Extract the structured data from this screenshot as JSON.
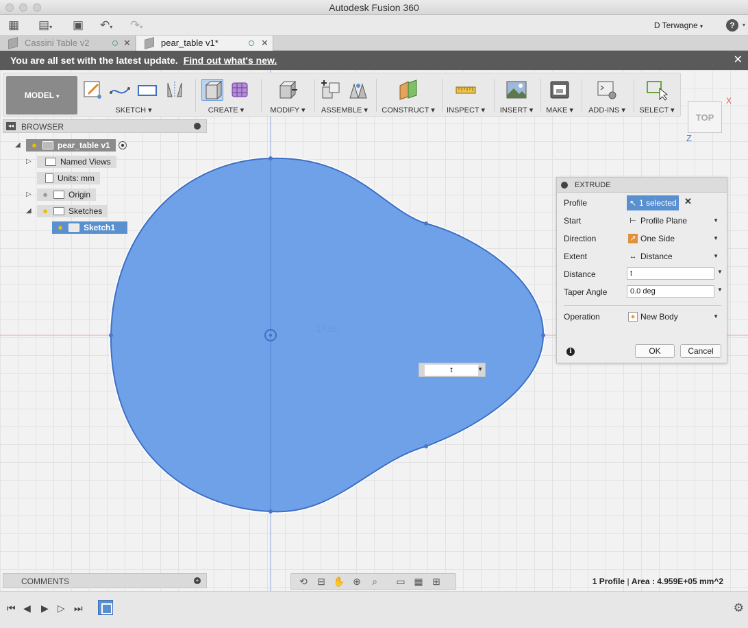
{
  "window": {
    "title": "Autodesk Fusion 360"
  },
  "appbar": {
    "user": "D Terwagne",
    "help_icon": "?",
    "icons": [
      "grid-icon",
      "file-icon",
      "save-icon",
      "undo-icon",
      "redo-icon"
    ]
  },
  "tabs": [
    {
      "label": "Cassini Table v2",
      "active": false
    },
    {
      "label": "pear_table v1*",
      "active": true
    }
  ],
  "banner": {
    "text": "You are all set with the latest update.",
    "link": "Find out what's new."
  },
  "toolbar": {
    "workspace": "MODEL",
    "groups": [
      {
        "label": "SKETCH"
      },
      {
        "label": "CREATE"
      },
      {
        "label": "MODIFY"
      },
      {
        "label": "ASSEMBLE"
      },
      {
        "label": "CONSTRUCT"
      },
      {
        "label": "INSPECT"
      },
      {
        "label": "INSERT"
      },
      {
        "label": "MAKE"
      },
      {
        "label": "ADD-INS"
      },
      {
        "label": "SELECT"
      }
    ]
  },
  "viewcube": {
    "face": "TOP",
    "x_axis": "X",
    "z_axis": "Z"
  },
  "browser": {
    "title": "BROWSER",
    "root": "pear_table v1",
    "items": [
      {
        "label": "Named Views"
      },
      {
        "label": "Units: mm"
      },
      {
        "label": "Origin"
      },
      {
        "label": "Sketches"
      },
      {
        "label": "Sketch1"
      }
    ]
  },
  "extrude": {
    "title": "EXTRUDE",
    "rows": {
      "profile": {
        "label": "Profile",
        "value": "1 selected"
      },
      "start": {
        "label": "Start",
        "value": "Profile Plane"
      },
      "direction": {
        "label": "Direction",
        "value": "One Side"
      },
      "extent": {
        "label": "Extent",
        "value": "Distance"
      },
      "distance": {
        "label": "Distance",
        "value": "t"
      },
      "taper": {
        "label": "Taper Angle",
        "value": "0.0 deg"
      },
      "operation": {
        "label": "Operation",
        "value": "New Body"
      }
    },
    "ok": "OK",
    "cancel": "Cancel"
  },
  "canvas": {
    "dimension_input": "t",
    "dimension_hint": "17.50",
    "shape_fill": "#6fa1e8",
    "shape_stroke": "#3f6fc4"
  },
  "comments": {
    "title": "COMMENTS"
  },
  "status": {
    "profiles": "1 Profile",
    "area": "Area : 4.959E+05 mm^2"
  },
  "colors": {
    "selection": "#5a8fd0",
    "banner": "#5a5a5a"
  }
}
